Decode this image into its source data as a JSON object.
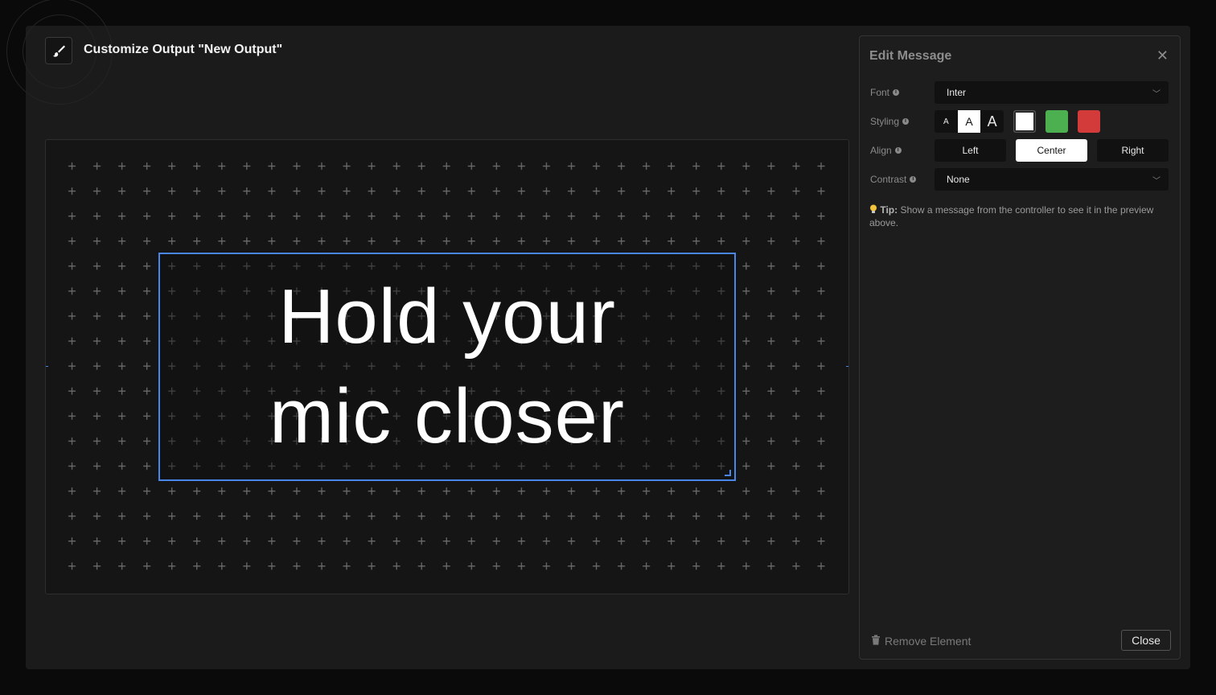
{
  "header": {
    "title": "Customize Output \"New Output\"",
    "icon": "paintbrush-icon"
  },
  "preview": {
    "message": "Hold your mic closer",
    "message_lines": [
      "Hold your",
      "mic closer"
    ],
    "accent_color": "#4a86e8"
  },
  "panel": {
    "title": "Edit Message",
    "close_glyph": "✕",
    "font": {
      "label": "Font",
      "value": "Inter"
    },
    "styling": {
      "label": "Styling",
      "sizes": [
        {
          "label": "A",
          "active": false
        },
        {
          "label": "A",
          "active": true
        },
        {
          "label": "A",
          "active": false
        }
      ],
      "colors": [
        "#ffffff",
        "#4caf50",
        "#d33b3b"
      ]
    },
    "align": {
      "label": "Align",
      "options": [
        "Left",
        "Center",
        "Right"
      ],
      "selected": "Center"
    },
    "contrast": {
      "label": "Contrast",
      "value": "None"
    },
    "tip": {
      "icon": "lightbulb-icon",
      "prefix": "Tip:",
      "text": "Show a message from the controller to see it in the preview above."
    },
    "remove_label": "Remove Element",
    "close_label": "Close"
  }
}
